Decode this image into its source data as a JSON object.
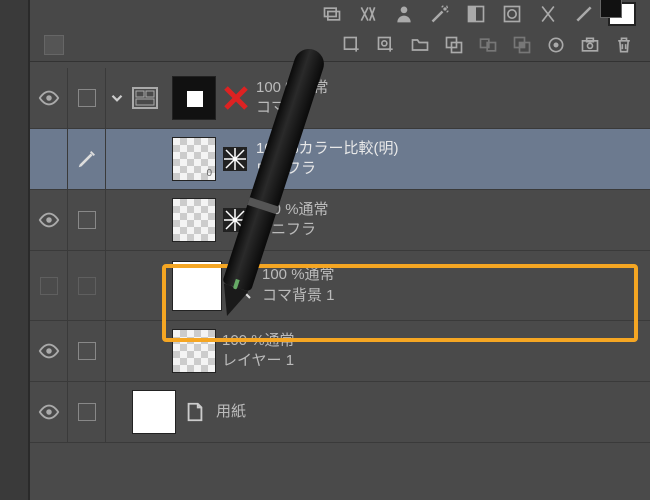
{
  "toolbar1": {
    "icons": [
      "layers-icon",
      "fx-icon",
      "person-icon",
      "wand-icon",
      "mask-icon",
      "palette-icon",
      "adj-icon",
      "clip-icon",
      "swatch-icon"
    ]
  },
  "toolbar2": {
    "icons": [
      "panel-toggle",
      "new-layer",
      "new-vector",
      "new-folder",
      "copy-layer",
      "move-layer",
      "link-layer",
      "merge-layer",
      "record-layer",
      "snapshot",
      "delete-layer"
    ]
  },
  "layers": [
    {
      "visible": true,
      "locked": false,
      "kind": "folder",
      "thumb": "blackbox",
      "xmark": true,
      "mode": "100 %通常",
      "name": "コマ 1"
    },
    {
      "visible": false,
      "editing": true,
      "kind": "burst",
      "thumb": "checker-0",
      "selected": true,
      "mode": "100 %カラー比較(明)",
      "name": "ウニフラ"
    },
    {
      "visible": true,
      "locked": false,
      "kind": "burst",
      "thumb": "checker",
      "mode": "100 %通常",
      "name": "ウニフラ"
    },
    {
      "visible": false,
      "locked": false,
      "kind": "3d",
      "thumb": "white",
      "highlighted": true,
      "mode": "100 %通常",
      "name": "コマ背景 1"
    },
    {
      "visible": true,
      "locked": false,
      "kind": "raster",
      "thumb": "checker",
      "mode": "100 %通常",
      "name": "レイヤー 1"
    },
    {
      "visible": true,
      "locked": false,
      "kind": "paper",
      "thumb": "white",
      "mode": "",
      "name": "用紙",
      "toplevel": true
    }
  ]
}
